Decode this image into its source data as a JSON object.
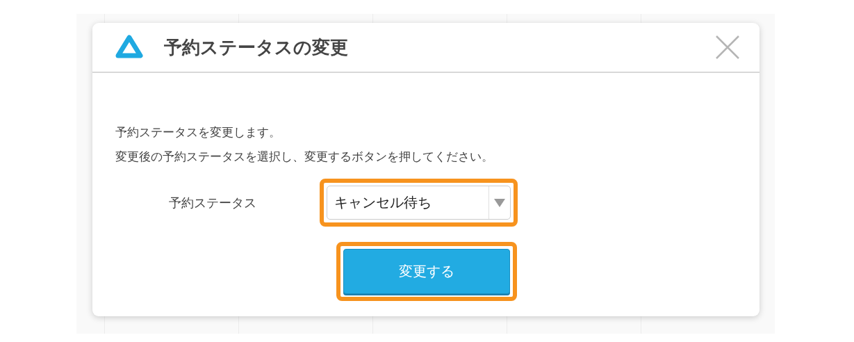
{
  "dialog": {
    "title": "予約ステータスの変更",
    "message": [
      "予約ステータスを変更します。",
      "変更後の予約ステータスを選択し、変更するボタンを押してください。"
    ],
    "field": {
      "label": "予約ステータス",
      "value": "キャンセル待ち",
      "highlighted": true
    },
    "submit": {
      "label": "変更する",
      "highlighted": true
    }
  }
}
